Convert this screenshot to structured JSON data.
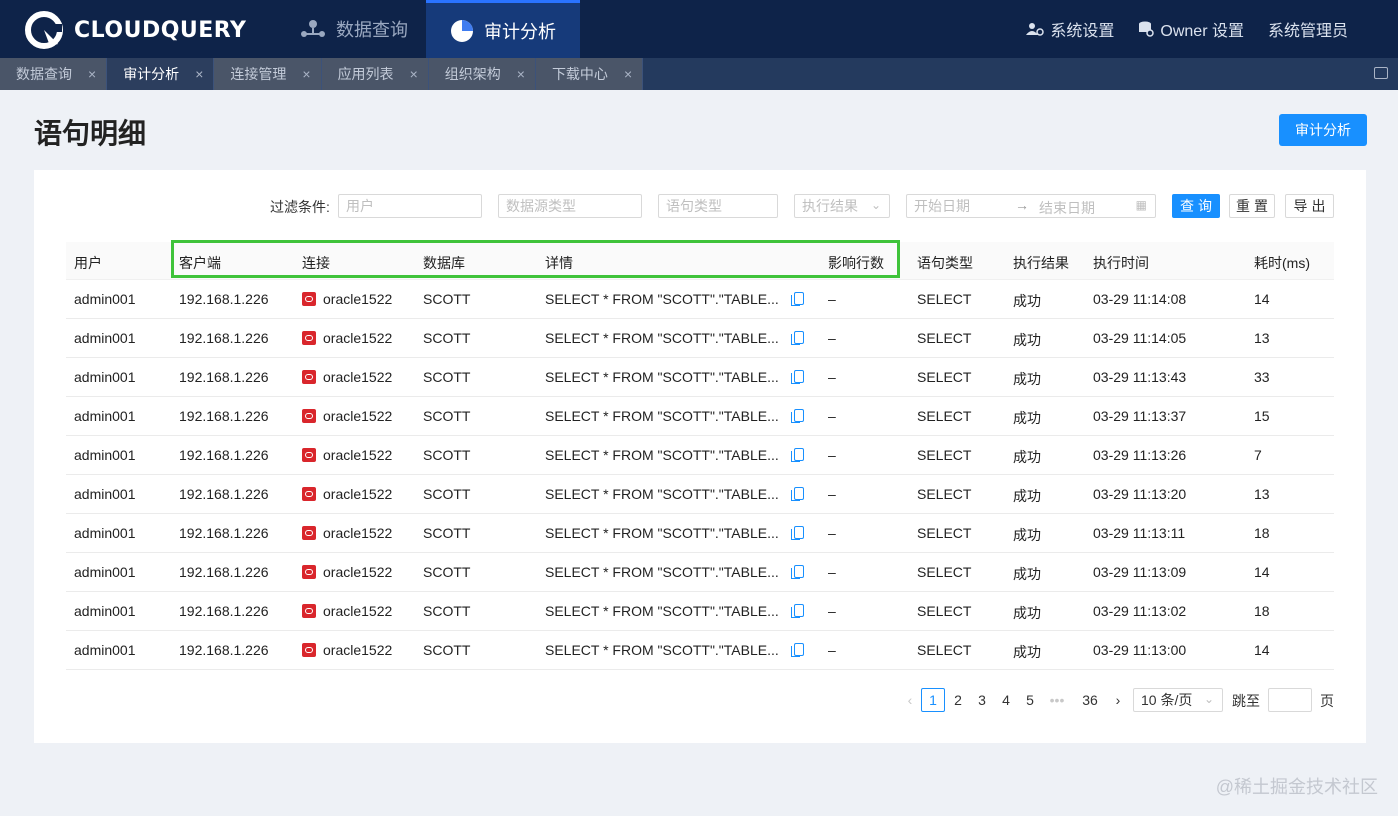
{
  "brand": {
    "name": "CLOUDQUERY"
  },
  "main_nav": [
    {
      "label": "数据查询",
      "icon": "network-icon"
    },
    {
      "label": "审计分析",
      "icon": "pie-chart-icon"
    }
  ],
  "right_nav": [
    {
      "label": "系统设置",
      "icon": "users-gear-icon"
    },
    {
      "label": "Owner 设置",
      "icon": "database-gear-icon"
    },
    {
      "label": "系统管理员"
    }
  ],
  "tabs": [
    {
      "label": "数据查询",
      "close": "×"
    },
    {
      "label": "审计分析",
      "close": "×"
    },
    {
      "label": "连接管理",
      "close": "×"
    },
    {
      "label": "应用列表",
      "close": "×"
    },
    {
      "label": "组织架构",
      "close": "×"
    },
    {
      "label": "下载中心",
      "close": "×"
    }
  ],
  "page": {
    "title": "语句明细",
    "action_button": "审计分析"
  },
  "filters": {
    "label": "过滤条件:",
    "user_placeholder": "用户",
    "datasource_placeholder": "数据源类型",
    "stmt_type_placeholder": "语句类型",
    "result_placeholder": "执行结果",
    "start_date_placeholder": "开始日期",
    "date_separator": "→",
    "end_date_placeholder": "结束日期",
    "query_button": "查询",
    "reset_button": "重置",
    "export_button": "导出"
  },
  "table": {
    "columns": [
      "用户",
      "客户端",
      "连接",
      "数据库",
      "详情",
      "影响行数",
      "语句类型",
      "执行结果",
      "执行时间",
      "耗时(ms)"
    ],
    "rows": [
      [
        "admin001",
        "192.168.1.226",
        "oracle1522",
        "SCOTT",
        "SELECT * FROM \"SCOTT\".\"TABLE...",
        "–",
        "SELECT",
        "成功",
        "03-29 11:14:08",
        "14"
      ],
      [
        "admin001",
        "192.168.1.226",
        "oracle1522",
        "SCOTT",
        "SELECT * FROM \"SCOTT\".\"TABLE...",
        "–",
        "SELECT",
        "成功",
        "03-29 11:14:05",
        "13"
      ],
      [
        "admin001",
        "192.168.1.226",
        "oracle1522",
        "SCOTT",
        "SELECT * FROM \"SCOTT\".\"TABLE...",
        "–",
        "SELECT",
        "成功",
        "03-29 11:13:43",
        "33"
      ],
      [
        "admin001",
        "192.168.1.226",
        "oracle1522",
        "SCOTT",
        "SELECT * FROM \"SCOTT\".\"TABLE...",
        "–",
        "SELECT",
        "成功",
        "03-29 11:13:37",
        "15"
      ],
      [
        "admin001",
        "192.168.1.226",
        "oracle1522",
        "SCOTT",
        "SELECT * FROM \"SCOTT\".\"TABLE...",
        "–",
        "SELECT",
        "成功",
        "03-29 11:13:26",
        "7"
      ],
      [
        "admin001",
        "192.168.1.226",
        "oracle1522",
        "SCOTT",
        "SELECT * FROM \"SCOTT\".\"TABLE...",
        "–",
        "SELECT",
        "成功",
        "03-29 11:13:20",
        "13"
      ],
      [
        "admin001",
        "192.168.1.226",
        "oracle1522",
        "SCOTT",
        "SELECT * FROM \"SCOTT\".\"TABLE...",
        "–",
        "SELECT",
        "成功",
        "03-29 11:13:11",
        "18"
      ],
      [
        "admin001",
        "192.168.1.226",
        "oracle1522",
        "SCOTT",
        "SELECT * FROM \"SCOTT\".\"TABLE...",
        "–",
        "SELECT",
        "成功",
        "03-29 11:13:09",
        "14"
      ],
      [
        "admin001",
        "192.168.1.226",
        "oracle1522",
        "SCOTT",
        "SELECT * FROM \"SCOTT\".\"TABLE...",
        "–",
        "SELECT",
        "成功",
        "03-29 11:13:02",
        "18"
      ],
      [
        "admin001",
        "192.168.1.226",
        "oracle1522",
        "SCOTT",
        "SELECT * FROM \"SCOTT\".\"TABLE...",
        "–",
        "SELECT",
        "成功",
        "03-29 11:13:00",
        "14"
      ]
    ]
  },
  "pagination": {
    "prev": "‹",
    "pages": [
      "1",
      "2",
      "3",
      "4",
      "5"
    ],
    "ellipsis": "•••",
    "last": "36",
    "next": "›",
    "current": "1",
    "page_size": "10 条/页",
    "jump_label": "跳至",
    "jump_suffix": "页"
  },
  "watermark": "@稀土掘金技术社区",
  "colors": {
    "header_bg": "#0e2349",
    "accent": "#1890ff",
    "highlight_box": "#3fc33a",
    "oracle_red": "#d9262c"
  }
}
